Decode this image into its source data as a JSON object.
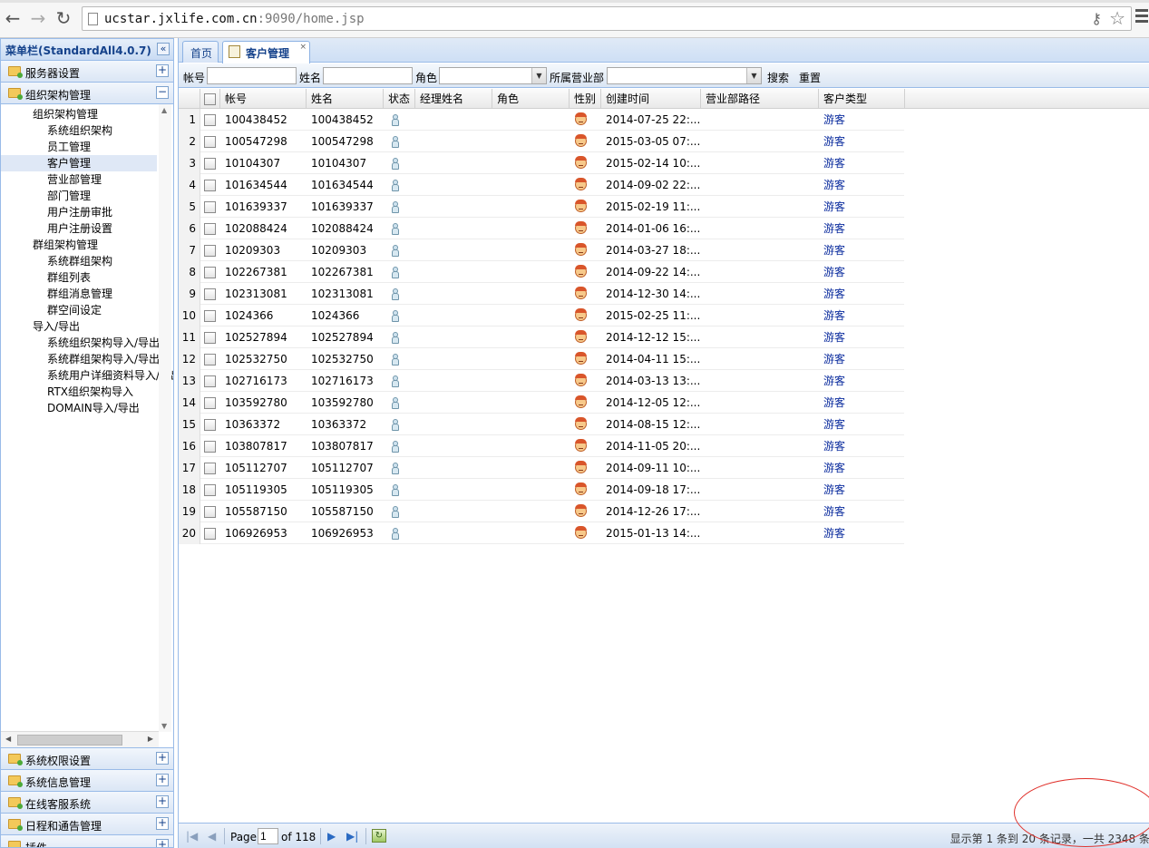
{
  "browser": {
    "url_host": "ucstar.jxlife.com.cn",
    "url_rest": ":9090/home.jsp"
  },
  "sidebar": {
    "title": "菜单栏(StandardAll4.0.7)",
    "collapse_glyph": "«",
    "sections_top": [
      {
        "label": "服务器设置",
        "tool": "+"
      },
      {
        "label": "组织架构管理",
        "tool": "−"
      }
    ],
    "tree": [
      {
        "label": "组织架构管理",
        "level": 1
      },
      {
        "label": "系统组织架构",
        "level": 2
      },
      {
        "label": "员工管理",
        "level": 2
      },
      {
        "label": "客户管理",
        "level": 2,
        "selected": true
      },
      {
        "label": "营业部管理",
        "level": 2
      },
      {
        "label": "部门管理",
        "level": 2
      },
      {
        "label": "用户注册审批",
        "level": 2
      },
      {
        "label": "用户注册设置",
        "level": 2
      },
      {
        "label": "群组架构管理",
        "level": 1
      },
      {
        "label": "系统群组架构",
        "level": 2
      },
      {
        "label": "群组列表",
        "level": 2
      },
      {
        "label": "群组消息管理",
        "level": 2
      },
      {
        "label": "群空间设定",
        "level": 2
      },
      {
        "label": "导入/导出",
        "level": 1
      },
      {
        "label": "系统组织架构导入/导出",
        "level": 2
      },
      {
        "label": "系统群组架构导入/导出",
        "level": 2
      },
      {
        "label": "系统用户详细资料导入/导出",
        "level": 2
      },
      {
        "label": "RTX组织架构导入",
        "level": 2
      },
      {
        "label": "DOMAIN导入/导出",
        "level": 2
      }
    ],
    "sections_bottom": [
      {
        "label": "系统权限设置",
        "tool": "+"
      },
      {
        "label": "系统信息管理",
        "tool": "+"
      },
      {
        "label": "在线客服系统",
        "tool": "+"
      },
      {
        "label": "日程和通告管理",
        "tool": "+"
      },
      {
        "label": "插件",
        "tool": "+"
      }
    ]
  },
  "tabs": [
    {
      "label": "首页",
      "active": false
    },
    {
      "label": "客户管理",
      "active": true,
      "close": "×"
    }
  ],
  "toolbar": {
    "account_label": "帐号",
    "name_label": "姓名",
    "role_label": "角色",
    "branch_label": "所属营业部",
    "search_label": "搜索",
    "reset_label": "重置",
    "account_value": "",
    "name_value": "",
    "role_value": "",
    "branch_value": ""
  },
  "grid": {
    "columns": [
      "帐号",
      "姓名",
      "状态",
      "经理姓名",
      "角色",
      "性别",
      "创建时间",
      "营业部路径",
      "客户类型"
    ],
    "rows": [
      [
        "1",
        "100438452",
        "100438452",
        "2014-07-25 22:...",
        "游客"
      ],
      [
        "2",
        "100547298",
        "100547298",
        "2015-03-05 07:...",
        "游客"
      ],
      [
        "3",
        "10104307",
        "10104307",
        "2015-02-14 10:...",
        "游客"
      ],
      [
        "4",
        "101634544",
        "101634544",
        "2014-09-02 22:...",
        "游客"
      ],
      [
        "5",
        "101639337",
        "101639337",
        "2015-02-19 11:...",
        "游客"
      ],
      [
        "6",
        "102088424",
        "102088424",
        "2014-01-06 16:...",
        "游客"
      ],
      [
        "7",
        "10209303",
        "10209303",
        "2014-03-27 18:...",
        "游客"
      ],
      [
        "8",
        "102267381",
        "102267381",
        "2014-09-22 14:...",
        "游客"
      ],
      [
        "9",
        "102313081",
        "102313081",
        "2014-12-30 14:...",
        "游客"
      ],
      [
        "10",
        "1024366",
        "1024366",
        "2015-02-25 11:...",
        "游客"
      ],
      [
        "11",
        "102527894",
        "102527894",
        "2014-12-12 15:...",
        "游客"
      ],
      [
        "12",
        "102532750",
        "102532750",
        "2014-04-11 15:...",
        "游客"
      ],
      [
        "13",
        "102716173",
        "102716173",
        "2014-03-13 13:...",
        "游客"
      ],
      [
        "14",
        "103592780",
        "103592780",
        "2014-12-05 12:...",
        "游客"
      ],
      [
        "15",
        "10363372",
        "10363372",
        "2014-08-15 12:...",
        "游客"
      ],
      [
        "16",
        "103807817",
        "103807817",
        "2014-11-05 20:...",
        "游客"
      ],
      [
        "17",
        "105112707",
        "105112707",
        "2014-09-11 10:...",
        "游客"
      ],
      [
        "18",
        "105119305",
        "105119305",
        "2014-09-18 17:...",
        "游客"
      ],
      [
        "19",
        "105587150",
        "105587150",
        "2014-12-26 17:...",
        "游客"
      ],
      [
        "20",
        "106926953",
        "106926953",
        "2015-01-13 14:...",
        "游客"
      ]
    ]
  },
  "paging": {
    "page_label": "Page",
    "page_value": "1",
    "of_label": "of 118",
    "info": "显示第 1 条到 20 条记录，一共 2348 条"
  },
  "colors": {
    "accent": "#15428b",
    "border": "#99bbe8",
    "annotation": "#e0302a"
  }
}
